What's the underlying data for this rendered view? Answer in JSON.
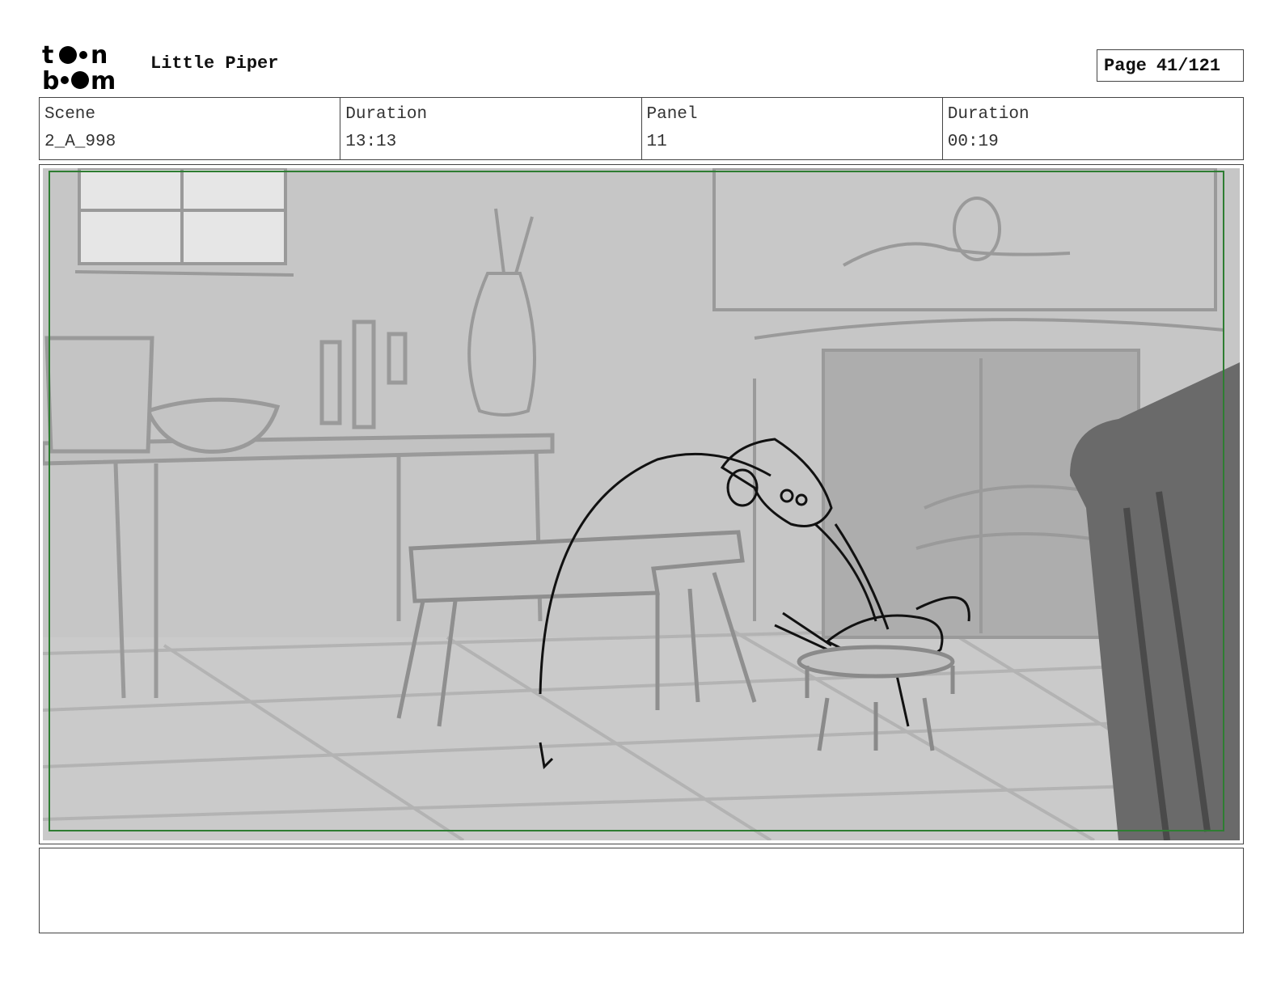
{
  "header": {
    "logo_text": "toon boom",
    "project_title": "Little Piper",
    "page_label": "Page",
    "page_value": "41/121"
  },
  "info": {
    "scene_label": "Scene",
    "scene_value": "2_A_998",
    "scene_duration_label": "Duration",
    "scene_duration_value": "13:13",
    "panel_label": "Panel",
    "panel_value": "11",
    "panel_duration_label": "Duration",
    "panel_duration_value": "00:19"
  },
  "panel": {
    "safe_frame_color": "#2e7d32",
    "background_color": "#c9c9c9"
  },
  "notes": {
    "text": ""
  }
}
